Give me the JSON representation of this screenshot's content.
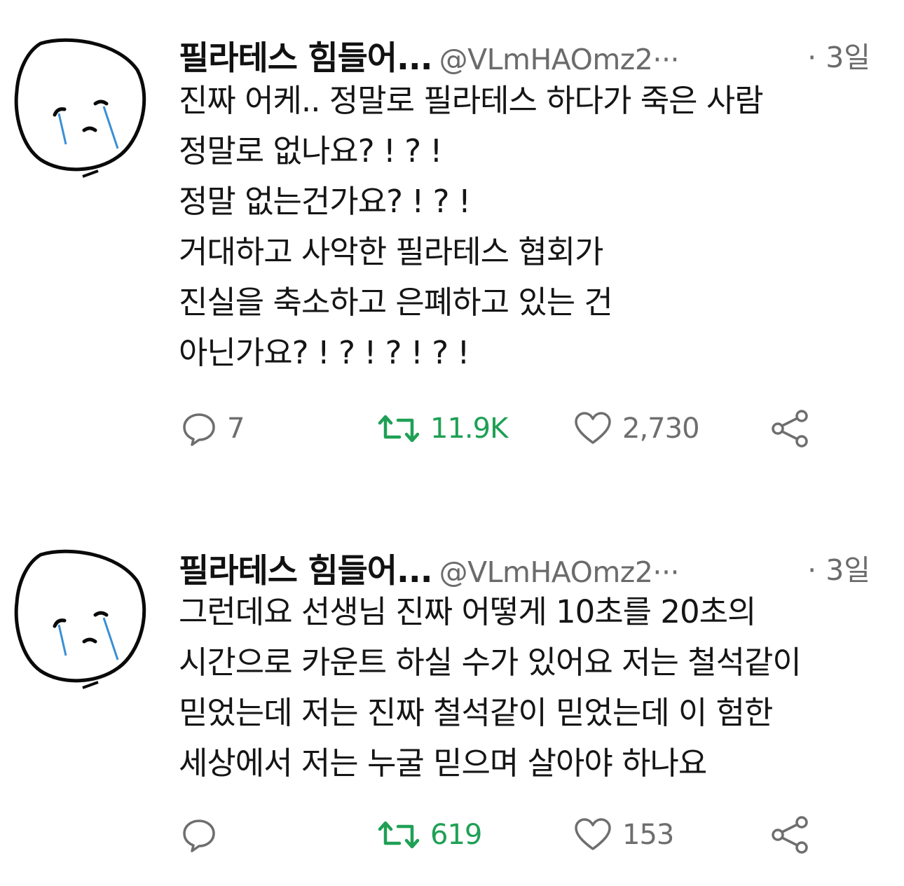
{
  "tweets": [
    {
      "author_name": "필라테스 힘들어...",
      "handle": "@VLmHAOmz2···",
      "time": "· 3일",
      "lines": [
        "진짜 어케.. 정말로 필라테스 하다가 죽은 사람",
        "정말로 없나요? ! ? !",
        "정말 없는건가요? ! ? !",
        "거대하고 사악한 필라테스 협회가",
        "진실을 축소하고 은폐하고 있는 건",
        "아닌가요? ! ? ! ? ! ? !"
      ],
      "replies": "7",
      "retweets": "11.9K",
      "likes": "2,730"
    },
    {
      "author_name": "필라테스 힘들어...",
      "handle": "@VLmHAOmz2···",
      "time": "· 3일",
      "lines": [
        "그런데요 선생님 진짜 어떻게 10초를 20초의",
        "시간으로 카운트 하실 수가 있어요 저는 철석같이",
        "믿었는데 저는 진짜 철석같이 믿었는데 이 험한",
        "세상에서 저는 누굴 믿으며 살아야 하나요"
      ],
      "replies": "",
      "retweets": "619",
      "likes": "153"
    }
  ],
  "colors": {
    "retweet": "#1fa055",
    "muted": "#6e6e6e",
    "tear": "#3a8fd6"
  },
  "icons": [
    "crying-face-avatar",
    "reply-icon",
    "retweet-icon",
    "heart-icon",
    "share-icon"
  ]
}
